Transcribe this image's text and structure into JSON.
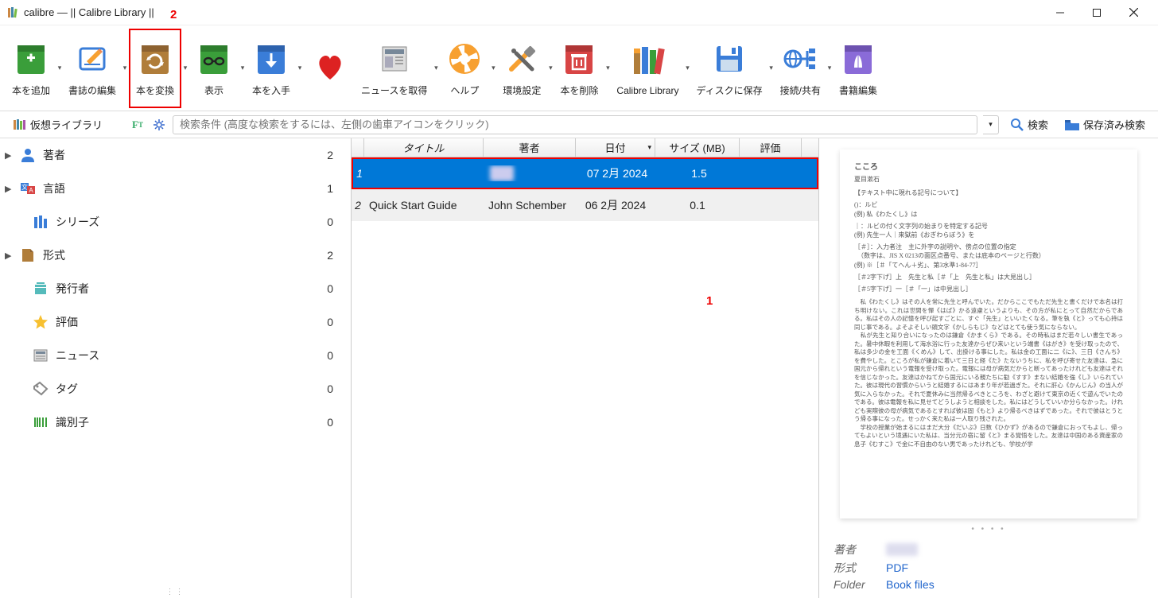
{
  "titlebar": {
    "title": "calibre — || Calibre Library ||",
    "annotation_2": "2"
  },
  "toolbar": {
    "items": [
      {
        "label": "本を追加",
        "icon": "add-book",
        "dropdown": true
      },
      {
        "label": "書誌の編集",
        "icon": "edit-metadata",
        "dropdown": true
      },
      {
        "label": "本を変換",
        "icon": "convert-book",
        "dropdown": true,
        "highlighted": true
      },
      {
        "label": "表示",
        "icon": "view-book",
        "dropdown": true
      },
      {
        "label": "本を入手",
        "icon": "get-books",
        "dropdown": true
      },
      {
        "label": "",
        "icon": "heart",
        "dropdown": false
      },
      {
        "label": "ニュースを取得",
        "icon": "fetch-news",
        "dropdown": true
      },
      {
        "label": "ヘルプ",
        "icon": "help",
        "dropdown": true
      },
      {
        "label": "環境設定",
        "icon": "preferences",
        "dropdown": true
      },
      {
        "label": "本を削除",
        "icon": "remove-book",
        "dropdown": true
      },
      {
        "label": "Calibre Library",
        "icon": "library",
        "dropdown": true
      },
      {
        "label": "ディスクに保存",
        "icon": "save-disk",
        "dropdown": true
      },
      {
        "label": "接続/共有",
        "icon": "connect-share",
        "dropdown": true
      },
      {
        "label": "書籍編集",
        "icon": "edit-book",
        "dropdown": false
      }
    ]
  },
  "searchrow": {
    "virtual_library": "仮想ライブラリ",
    "placeholder": "検索条件 (高度な検索をするには、左側の歯車アイコンをクリック)",
    "search_btn": "検索",
    "saved_search": "保存済み検索"
  },
  "sidebar": {
    "items": [
      {
        "label": "著者",
        "count": "2",
        "icon": "person",
        "arrow": true,
        "indent": false
      },
      {
        "label": "言語",
        "count": "1",
        "icon": "language",
        "arrow": true,
        "indent": false
      },
      {
        "label": "シリーズ",
        "count": "0",
        "icon": "series",
        "arrow": false,
        "indent": true
      },
      {
        "label": "形式",
        "count": "2",
        "icon": "format",
        "arrow": true,
        "indent": false
      },
      {
        "label": "発行者",
        "count": "0",
        "icon": "publisher",
        "arrow": false,
        "indent": true
      },
      {
        "label": "評価",
        "count": "0",
        "icon": "rating",
        "arrow": false,
        "indent": true
      },
      {
        "label": "ニュース",
        "count": "0",
        "icon": "news",
        "arrow": false,
        "indent": true
      },
      {
        "label": "タグ",
        "count": "0",
        "icon": "tag",
        "arrow": false,
        "indent": true
      },
      {
        "label": "識別子",
        "count": "0",
        "icon": "identifier",
        "arrow": false,
        "indent": true
      }
    ]
  },
  "table": {
    "annotation_1": "1",
    "headers": {
      "title": "タイトル",
      "author": "著者",
      "date": "日付",
      "size": "サイズ (MB)",
      "rating": "評価"
    },
    "rows": [
      {
        "num": "1",
        "title": "",
        "author": "",
        "date": "07 2月 2024",
        "size": "1.5",
        "selected": true,
        "blurred": true
      },
      {
        "num": "2",
        "title": "Quick Start Guide",
        "author": "John Schember",
        "date": "06 2月 2024",
        "size": "0.1",
        "selected": false,
        "alt": true
      }
    ]
  },
  "details": {
    "preview_title": "こころ",
    "preview_author": "夏目漱石",
    "meta": {
      "author_label": "著者",
      "format_label": "形式",
      "format_value": "PDF",
      "folder_label": "Folder",
      "folder_value": "Book files"
    }
  }
}
